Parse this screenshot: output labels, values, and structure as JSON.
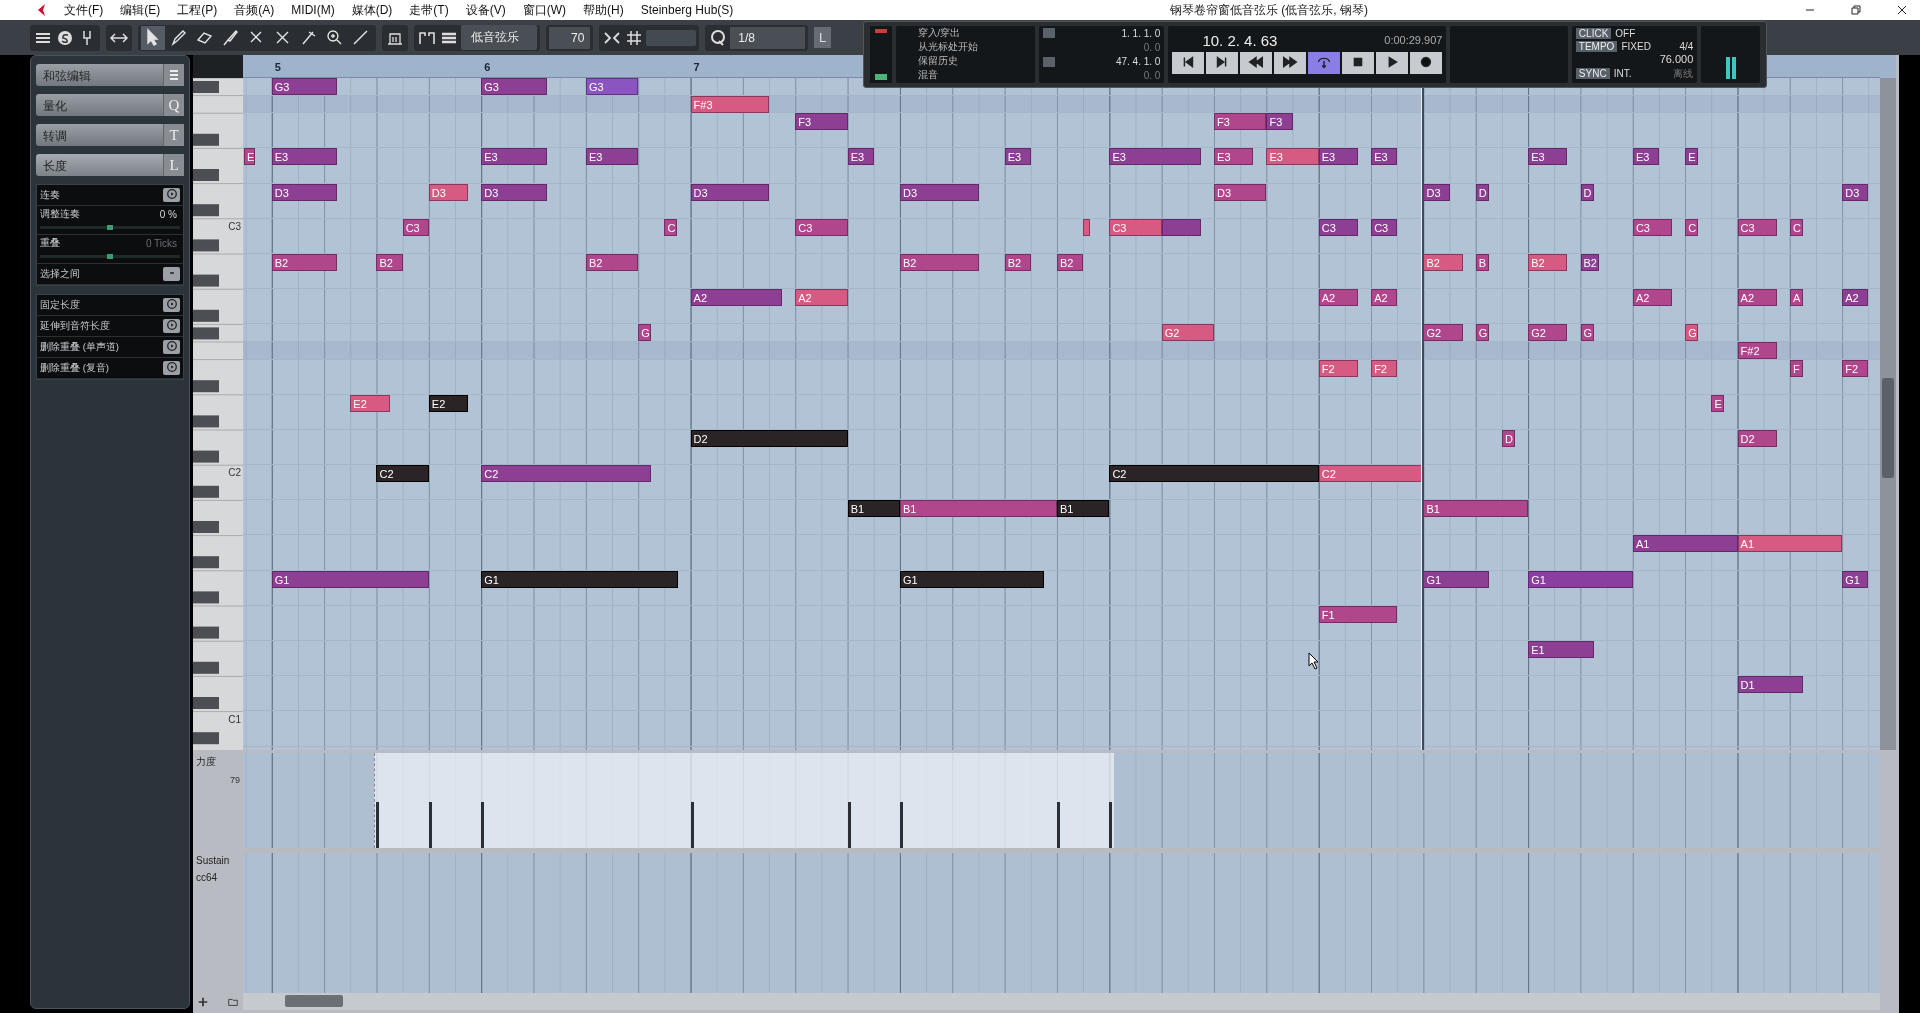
{
  "window": {
    "title": "钢琴卷帘窗低音弦乐 (低音弦乐, 钢琴)"
  },
  "menu": [
    "文件(F)",
    "编辑(E)",
    "工程(P)",
    "音频(A)",
    "MIDI(M)",
    "媒体(D)",
    "走带(T)",
    "设备(V)",
    "窗口(W)",
    "帮助(H)",
    "Steinberg Hub(S)"
  ],
  "toolbar": {
    "tools": [
      {
        "kind": "select",
        "selected": true
      },
      {
        "kind": "pencil",
        "selected": false
      },
      {
        "kind": "eraser",
        "selected": false
      },
      {
        "kind": "brush",
        "selected": false
      },
      {
        "kind": "scissors",
        "selected": false
      },
      {
        "kind": "mute",
        "selected": false
      },
      {
        "kind": "glue",
        "selected": false
      },
      {
        "kind": "zoom",
        "selected": false
      },
      {
        "kind": "line",
        "selected": false
      }
    ],
    "track": "低音弦乐",
    "velocity": "70",
    "quantize": "1/8",
    "length_key": "L"
  },
  "transport": {
    "options": [
      "穿入/穿出",
      "从光标处开始",
      "保留历史",
      "混音"
    ],
    "left_locator": "1. 1. 1. 0",
    "left_offset": "0. 0",
    "right_locator": "47. 4. 1. 0",
    "right_offset": "0. 0",
    "position": "10. 2. 4. 63",
    "time": "0:00:29.907",
    "buttons": [
      {
        "kind": "to-start",
        "on": false
      },
      {
        "kind": "to-end",
        "on": false
      },
      {
        "kind": "rewind",
        "on": false
      },
      {
        "kind": "forward",
        "on": false
      },
      {
        "kind": "cycle",
        "on": true
      },
      {
        "kind": "stop",
        "on": false
      },
      {
        "kind": "play",
        "on": false
      },
      {
        "kind": "record",
        "on": false
      }
    ],
    "click": {
      "label": "CLICK",
      "value": "OFF"
    },
    "tempo": {
      "label": "TEMPO",
      "value": "FIXED",
      "signature": "4/4",
      "bpm": "76.000"
    },
    "sync": {
      "label": "SYNC",
      "value": "INT.",
      "mode": "离线"
    }
  },
  "inspector": {
    "sections": [
      {
        "title": "和弦编辑",
        "expanded": false
      },
      {
        "title": "量化",
        "key": "Q",
        "expanded": false
      },
      {
        "title": "转调",
        "key": "T",
        "expanded": false
      },
      {
        "title": "长度",
        "key": "L",
        "expanded": true,
        "groups": [
          {
            "rows": [
              {
                "kind": "action",
                "label": "连奏"
              },
              {
                "kind": "slider",
                "label": "调整连奏",
                "value": "0 %",
                "disabled": false,
                "level": 0.5
              },
              {
                "kind": "slider",
                "label": "重叠",
                "value": "0 Ticks",
                "disabled": true,
                "level": 0.5
              },
              {
                "kind": "option",
                "label": "选择之间"
              }
            ]
          },
          {
            "rows": [
              {
                "kind": "action",
                "label": "固定长度"
              },
              {
                "kind": "action",
                "label": "延伸到音符长度"
              },
              {
                "kind": "action",
                "label": "删除重叠 (单声道)"
              },
              {
                "kind": "action",
                "label": "删除重叠 (复音)"
              }
            ]
          }
        ]
      }
    ]
  },
  "editor": {
    "bars": [
      "5",
      "6",
      "7"
    ],
    "lanes": [
      {
        "kind": "natural",
        "notes": [
          {
            "label": "G3",
            "color": "#8d3f93",
            "selected": false
          },
          {
            "label": "G3",
            "color": "#8d3f93",
            "selected": false
          },
          {
            "label": "G3",
            "color": "#8a55c0",
            "selected": false
          }
        ]
      },
      {
        "kind": "sharp",
        "notes": [
          {
            "label": "F#3",
            "color": "#d65a82",
            "selected": false
          }
        ]
      },
      {
        "kind": "natural",
        "notes": [
          {
            "label": "F3",
            "color": "#8d3f93",
            "selected": false
          },
          {
            "label": "F3",
            "color": "#b0468c",
            "selected": false
          },
          {
            "label": "F3",
            "color": "#8d3f93",
            "selected": false
          }
        ]
      },
      {
        "kind": "natural",
        "notes": [
          {
            "label": "E",
            "color": "#b0468c",
            "selected": false
          },
          {
            "label": "E3",
            "color": "#8d3f93",
            "selected": false
          },
          {
            "label": "E3",
            "color": "#8d3f93",
            "selected": false
          },
          {
            "label": "E3",
            "color": "#8d3f93",
            "selected": false
          },
          {
            "label": "E3",
            "color": "#8d3f93",
            "selected": false
          },
          {
            "label": "E3",
            "color": "#8d3f93",
            "selected": false
          },
          {
            "label": "E3",
            "color": "#8d3f93",
            "selected": false
          },
          {
            "label": "E3",
            "color": "#b0468c",
            "selected": false
          },
          {
            "label": "E3",
            "color": "#d65a82",
            "selected": false
          },
          {
            "label": "E3",
            "color": "#8d3f93",
            "selected": false
          },
          {
            "label": "E3",
            "color": "#8d3f93",
            "selected": false
          },
          {
            "label": "E3",
            "color": "#8d3f93",
            "selected": false
          },
          {
            "label": "E3",
            "color": "#8d3f93",
            "selected": false
          },
          {
            "label": "E",
            "color": "#8d3f93",
            "selected": false
          }
        ]
      },
      {
        "kind": "natural",
        "notes": [
          {
            "label": "D3",
            "color": "#8d3f93",
            "selected": false
          },
          {
            "label": "D3",
            "color": "#d65a82",
            "selected": false
          },
          {
            "label": "D3",
            "color": "#8d3f93",
            "selected": false
          },
          {
            "label": "D3",
            "color": "#8d3f93",
            "selected": false
          },
          {
            "label": "D3",
            "color": "#8d3f93",
            "selected": false
          },
          {
            "label": "D3",
            "color": "#b0468c",
            "selected": false
          },
          {
            "label": "D3",
            "color": "#8d3f93",
            "selected": false
          },
          {
            "label": "D",
            "color": "#8d3f93",
            "selected": false
          },
          {
            "label": "D",
            "color": "#8d3f93",
            "selected": false
          },
          {
            "label": "D3",
            "color": "#8d3f93",
            "selected": false
          }
        ]
      },
      {
        "kind": "natural",
        "key_label": "C3",
        "notes": [
          {
            "label": "C3",
            "color": "#b0468c",
            "selected": false
          },
          {
            "label": "C",
            "color": "#b0468c",
            "selected": false
          },
          {
            "label": "C3",
            "color": "#b0468c",
            "selected": false
          },
          {
            "color": "#d65a82",
            "selected": false
          },
          {
            "label": "C3",
            "color": "#d65a82",
            "selected": false
          },
          {
            "color": "#8d3f93",
            "selected": false
          },
          {
            "label": "C3",
            "color": "#8d3f93",
            "selected": false
          },
          {
            "label": "C3",
            "color": "#8d3f93",
            "selected": false
          },
          {
            "label": "C3",
            "color": "#b0468c",
            "selected": false
          },
          {
            "label": "C",
            "color": "#b0468c",
            "selected": false
          },
          {
            "label": "C3",
            "color": "#b0468c",
            "selected": false
          },
          {
            "label": "C",
            "color": "#b0468c",
            "selected": false
          }
        ]
      },
      {
        "kind": "natural",
        "notes": [
          {
            "label": "B2",
            "color": "#b0468c",
            "selected": false
          },
          {
            "label": "B2",
            "color": "#b0468c",
            "selected": false
          },
          {
            "label": "B2",
            "color": "#b0468c",
            "selected": false
          },
          {
            "label": "B2",
            "color": "#b0468c",
            "selected": false
          },
          {
            "label": "B2",
            "color": "#b0468c",
            "selected": false
          },
          {
            "label": "B2",
            "color": "#b0468c",
            "selected": false
          },
          {
            "label": "B2",
            "color": "#d65a82",
            "selected": false
          },
          {
            "label": "B",
            "color": "#b0468c",
            "selected": false
          },
          {
            "label": "B2",
            "color": "#d65a82",
            "selected": false
          },
          {
            "label": "B2",
            "color": "#8d3f93",
            "selected": false
          }
        ]
      },
      {
        "kind": "natural",
        "notes": [
          {
            "label": "A2",
            "color": "#8d3f93",
            "selected": false
          },
          {
            "label": "A2",
            "color": "#d65a82",
            "selected": false
          },
          {
            "label": "A2",
            "color": "#b0468c",
            "selected": false
          },
          {
            "label": "A2",
            "color": "#b0468c",
            "selected": false
          },
          {
            "label": "A2",
            "color": "#b0468c",
            "selected": false
          },
          {
            "label": "A2",
            "color": "#b0468c",
            "selected": false
          },
          {
            "label": "A",
            "color": "#b0468c",
            "selected": false
          },
          {
            "label": "A2",
            "color": "#8d3f93",
            "selected": false
          }
        ]
      },
      {
        "kind": "natural",
        "notes": [
          {
            "label": "G",
            "color": "#b0468c",
            "selected": false
          },
          {
            "label": "G2",
            "color": "#d65a82",
            "selected": false
          },
          {
            "label": "G2",
            "color": "#b0468c",
            "selected": false
          },
          {
            "label": "G",
            "color": "#b0468c",
            "selected": false
          },
          {
            "label": "G2",
            "color": "#b0468c",
            "selected": false
          },
          {
            "label": "G",
            "color": "#b0468c",
            "selected": false
          },
          {
            "label": "G",
            "color": "#d65a82",
            "selected": false
          }
        ]
      },
      {
        "kind": "sharp",
        "notes": [
          {
            "label": "F#2",
            "color": "#b0468c",
            "selected": false
          }
        ]
      },
      {
        "kind": "natural",
        "notes": [
          {
            "label": "F2",
            "color": "#d65a82",
            "selected": false
          },
          {
            "label": "F2",
            "color": "#d65a82",
            "selected": false
          },
          {
            "label": "F",
            "color": "#b0468c",
            "selected": false
          },
          {
            "label": "F2",
            "color": "#b0468c",
            "selected": false
          }
        ]
      },
      {
        "kind": "natural",
        "notes": [
          {
            "label": "E2",
            "color": "#d65a82",
            "selected": false
          },
          {
            "label": "E2",
            "selected": true
          },
          {
            "label": "E",
            "color": "#b0468c",
            "selected": false
          }
        ]
      },
      {
        "kind": "natural",
        "notes": [
          {
            "label": "D2",
            "selected": true
          },
          {
            "label": "D",
            "color": "#b0468c",
            "selected": false
          },
          {
            "label": "D2",
            "color": "#b0468c",
            "selected": false
          }
        ]
      },
      {
        "kind": "natural",
        "key_label": "C2",
        "notes": [
          {
            "label": "C2",
            "selected": true
          },
          {
            "label": "C2",
            "color": "#8d3f93",
            "selected": false
          },
          {
            "label": "C2",
            "selected": true
          },
          {
            "label": "C2",
            "color": "#d65a82",
            "selected": false
          }
        ]
      },
      {
        "kind": "natural",
        "notes": [
          {
            "label": "B1",
            "selected": true
          },
          {
            "label": "B1",
            "color": "#b0468c",
            "selected": false
          },
          {
            "label": "B1",
            "selected": true
          },
          {
            "label": "B1",
            "color": "#b0468c",
            "selected": false
          }
        ]
      },
      {
        "kind": "natural",
        "notes": [
          {
            "label": "A1",
            "color": "#8d3f93",
            "selected": false
          },
          {
            "label": "A1",
            "color": "#d65a82",
            "selected": false
          }
        ]
      },
      {
        "kind": "natural",
        "notes": [
          {
            "label": "G1",
            "color": "#8d3f93",
            "selected": false
          },
          {
            "label": "G1",
            "selected": true
          },
          {
            "label": "G1",
            "selected": true
          },
          {
            "label": "G1",
            "color": "#8d3f93",
            "selected": false
          },
          {
            "label": "G1",
            "color": "#8a3fa0",
            "selected": false
          },
          {
            "label": "G1",
            "color": "#8d3f93",
            "selected": false
          }
        ]
      },
      {
        "kind": "natural",
        "notes": [
          {
            "label": "F1",
            "color": "#b0468c",
            "selected": false
          }
        ]
      },
      {
        "kind": "natural",
        "notes": [
          {
            "label": "E1",
            "color": "#8d3f93",
            "selected": false
          }
        ]
      },
      {
        "kind": "natural",
        "notes": [
          {
            "label": "D1",
            "color": "#8d3f93",
            "selected": false
          }
        ]
      },
      {
        "kind": "natural",
        "key_label": "C1"
      }
    ],
    "velocity_lane": {
      "label": "力度",
      "scale": "79"
    },
    "sustain_lane": {
      "label": "Sustain",
      "controller": "cc64"
    }
  }
}
